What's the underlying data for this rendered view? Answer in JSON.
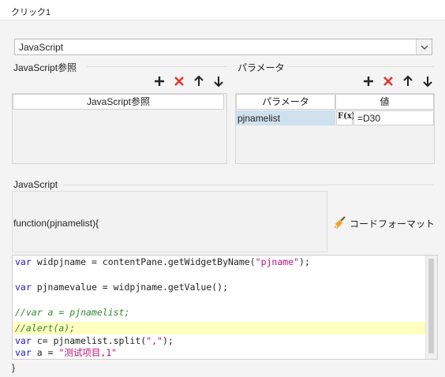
{
  "window": {
    "title": "クリック1"
  },
  "language_select": {
    "value": "JavaScript"
  },
  "js_ref": {
    "label": "JavaScript参照",
    "column": "JavaScript参照"
  },
  "params": {
    "label": "パラメータ",
    "col_name": "パラメータ",
    "col_value": "値",
    "rows": [
      {
        "name": "pjnamelist",
        "formula_icon": "F(x)",
        "value": "=D30"
      }
    ]
  },
  "script": {
    "label": "JavaScript",
    "signature": "function(pjnamelist){",
    "format_button": "コードフォーマット",
    "closing": "}",
    "lines": [
      {
        "kw": "var",
        "text": " widpjname = contentPane.getWidgetByName(",
        "str": "\"pjname\"",
        "tail": ");"
      },
      {
        "kw": "var",
        "text": " pjnamevalue = widpjname.getValue();",
        "str": "",
        "tail": ""
      },
      {
        "comment": "//var a = pjnamelist;"
      },
      {
        "comment": "//alert(a);"
      },
      {
        "kw": "var",
        "text": " c= pjnamelist.split(",
        "str": "\",\"",
        "tail": ");"
      },
      {
        "kw": "var",
        "text": " a = ",
        "str": "\"测试项目,1\"",
        "tail": ""
      }
    ]
  },
  "icons": {
    "add": "plus-icon",
    "delete": "x-icon",
    "up": "arrow-up-icon",
    "down": "arrow-down-icon",
    "format": "broom-icon"
  },
  "colors": {
    "delete": "#e8302a",
    "selected_row": "#cfe0ee",
    "keyword": "#1b1bbf",
    "string": "#b8157a",
    "comment": "#2f8a2f",
    "highlight": "#ffffc0"
  }
}
